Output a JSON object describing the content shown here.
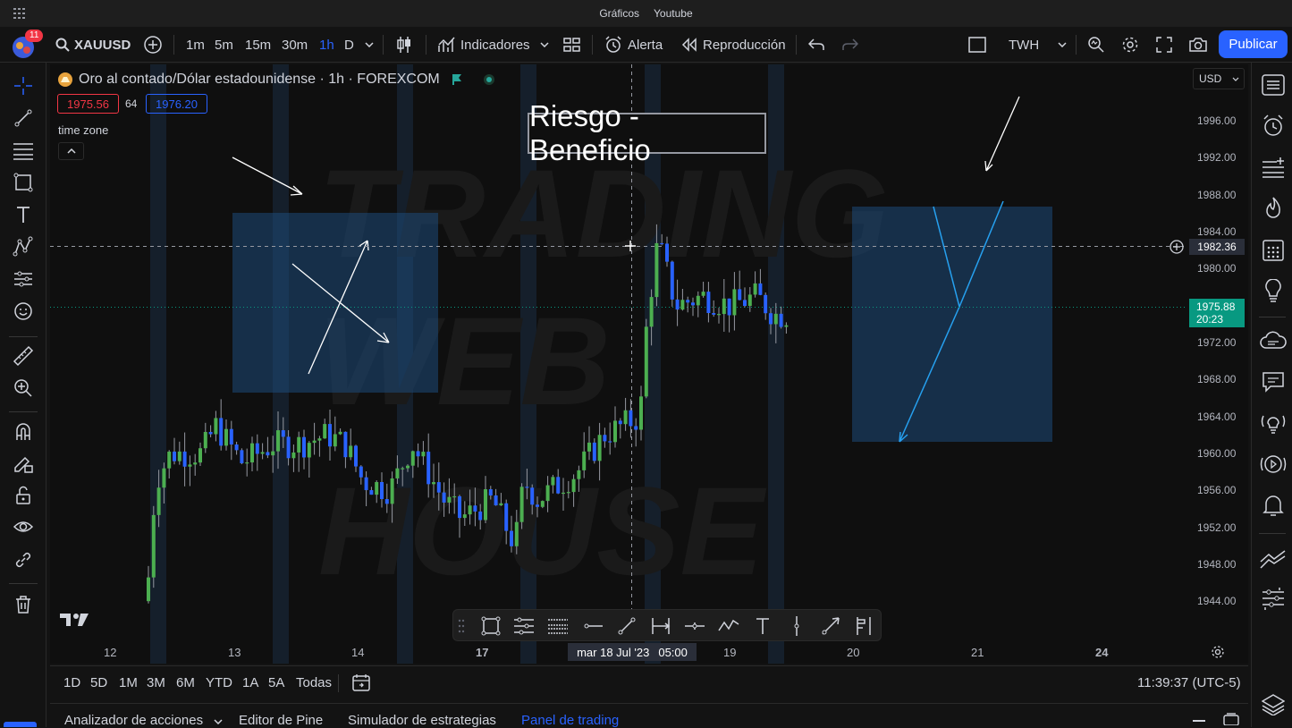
{
  "titlebar": {
    "left": "Gráficos",
    "right": "Youtube"
  },
  "header": {
    "notifications": "11",
    "symbol": "XAUUSD",
    "intervals": [
      "1m",
      "5m",
      "15m",
      "30m",
      "1h",
      "D"
    ],
    "active_interval": "1h",
    "indicators_label": "Indicadores",
    "alert_label": "Alerta",
    "replay_label": "Reproducción",
    "layout_name": "TWH",
    "publish_label": "Publicar"
  },
  "chart": {
    "title": "Oro al contado/Dólar estadounidense · 1h · FOREXCOM",
    "bid": "1975.56",
    "spread": "64",
    "ask": "1976.20",
    "timezone_label": "time zone",
    "currency": "USD",
    "annotation": "Riesgo - Beneficio",
    "crosshair_price": "1982.36",
    "last_price": "1975.88",
    "countdown": "20:23",
    "crosshair_date": "mar 18 Jul '23",
    "crosshair_time": "05:00",
    "y_ticks": [
      "1996.00",
      "1992.00",
      "1988.00",
      "1984.00",
      "1980.00",
      "1972.00",
      "1968.00",
      "1964.00",
      "1960.00",
      "1956.00",
      "1952.00",
      "1948.00",
      "1944.00"
    ],
    "x_ticks": [
      "12",
      "13",
      "14",
      "17",
      "19",
      "20",
      "21",
      "24"
    ]
  },
  "ranges": [
    "1D",
    "5D",
    "1M",
    "3M",
    "6M",
    "YTD",
    "1A",
    "5A",
    "Todas"
  ],
  "clock": "11:39:37 (UTC-5)",
  "panels": [
    "Analizador de acciones",
    "Editor de Pine",
    "Simulador de estrategias",
    "Panel de trading"
  ],
  "active_panel": "Panel de trading",
  "colors": {
    "accent": "#2962ff",
    "up": "#4caf50",
    "down": "#2962ff",
    "zone": "#1e4a7a",
    "last_price": "#089981"
  }
}
